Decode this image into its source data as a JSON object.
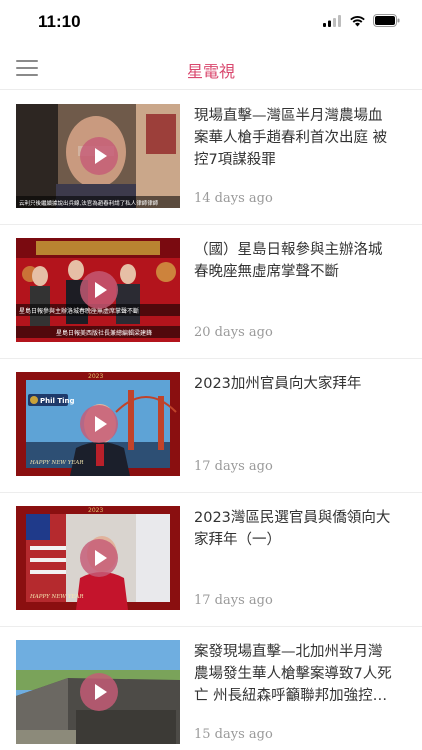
{
  "status_bar": {
    "time": "11:10"
  },
  "nav": {
    "title": "星電視"
  },
  "articles": [
    {
      "title": "現場直擊—灣區半月灣農場血案華人槍手趙春利首次出庭 被控7項謀殺罪",
      "time": "14 days ago",
      "thumb_caption": "云利只後繼續據說出兵線,法官為趙春利請了私人律師律師"
    },
    {
      "title": "（國）星島日報參與主辦洛城春晚座無虛席掌聲不斷",
      "time": "20 days ago",
      "thumb_caption": "星島日報參與主辦洛城春晚座無虛席掌聲不斷",
      "thumb_caption2": "星島日報美西版社長兼總編輯梁建鋒"
    },
    {
      "title": "2023加州官員向大家拜年",
      "time": "17 days ago",
      "thumb_year": "2023",
      "thumb_name": "Phil Ting",
      "thumb_greeting": "HAPPY NEW YEAR"
    },
    {
      "title": "2023灣區民選官員與僑領向大家拜年（一）",
      "time": "17 days ago",
      "thumb_year": "2023",
      "thumb_greeting": "HAPPY NEW YEAR"
    },
    {
      "title": "案發現場直擊—北加州半月灣農場發生華人槍擊案導致7人死亡 州長紐森呼籲聯邦加強控…",
      "time": "15 days ago"
    }
  ],
  "colors": {
    "accent": "#d9486e",
    "play_button": "#c65c76"
  },
  "icons": [
    "signal-icon",
    "wifi-icon",
    "battery-icon",
    "menu-icon",
    "play-icon"
  ]
}
